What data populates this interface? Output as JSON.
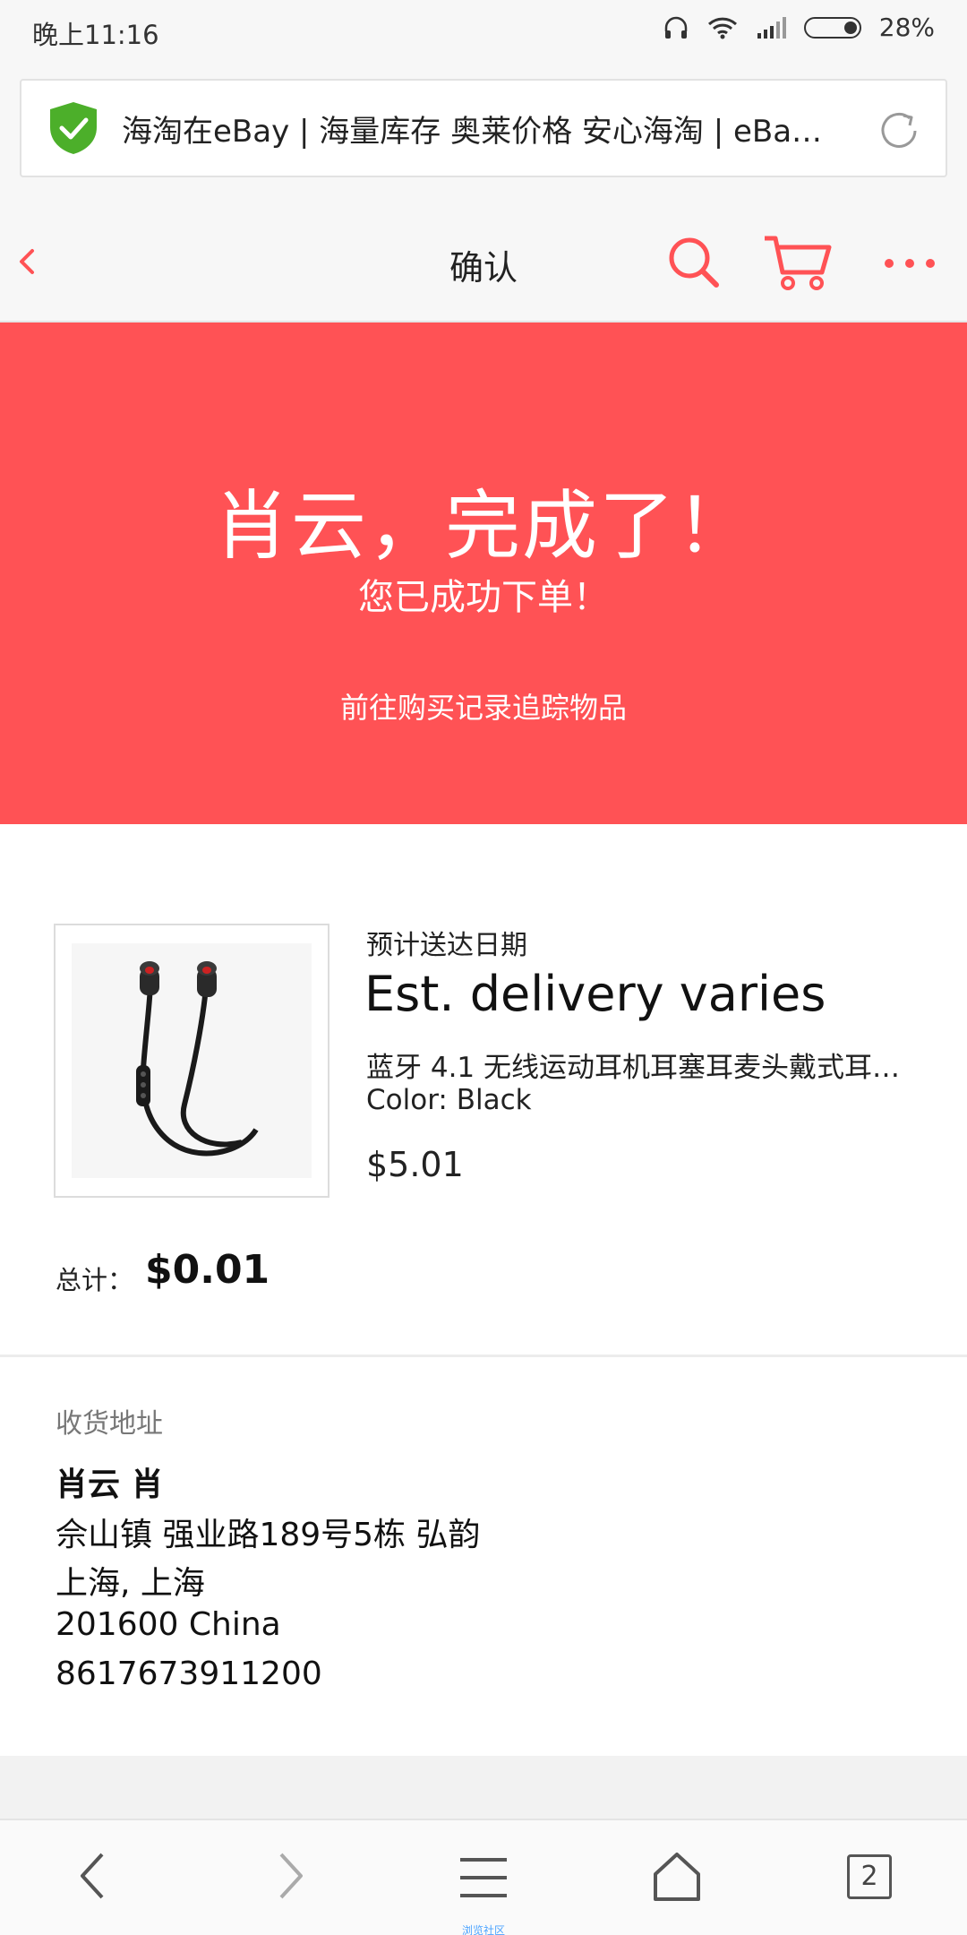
{
  "status_bar": {
    "time": "晚上11:16",
    "battery": "28%",
    "battery_level": 0.28
  },
  "browser": {
    "url_title": "海淘在eBay | 海量库存 奥莱价格 安心海淘 | eBa…",
    "secure_color": "#4caf2a"
  },
  "header": {
    "title": "确认",
    "accent": "#ff5255"
  },
  "banner": {
    "title": "肖云，完成了！",
    "subtitle": "您已成功下单！",
    "link": "前往购买记录追踪物品",
    "bg_color": "#ff5255"
  },
  "item": {
    "est_label": "预计送达日期",
    "est_value": "Est. delivery varies",
    "title": "蓝牙 4.1 无线运动耳机耳塞耳麦头戴式耳…",
    "color": "Color: Black",
    "price": "$5.01"
  },
  "total": {
    "label": "总计：",
    "value": "$0.01"
  },
  "address": {
    "heading": "收货地址",
    "name": "肖云 肖",
    "line1": "佘山镇 强业路189号5栋 弘韵",
    "line2": "上海, 上海",
    "line3": "201600 China",
    "phone": "8617673911200"
  },
  "bottom_nav": {
    "community_label": "浏览社区",
    "tab_count": "2"
  }
}
